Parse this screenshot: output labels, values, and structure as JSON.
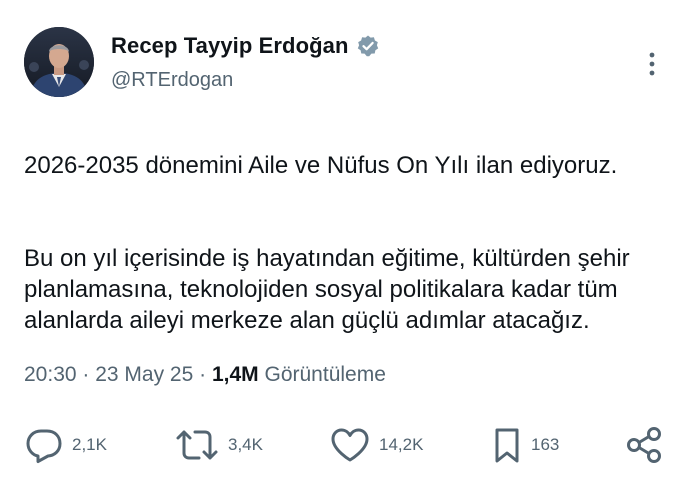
{
  "author": {
    "display_name": "Recep Tayyip Erdoğan",
    "handle": "@RTErdogan",
    "verified": true,
    "avatar": "profile-photo"
  },
  "tweet": {
    "paragraph_1": "2026-2035 dönemini Aile ve Nüfus On Yılı ilan ediyoruz.",
    "paragraph_2": "Bu on yıl içerisinde iş hayatından eğitime, kültürden şehir planlamasına, teknolojiden sosyal politikalara kadar tüm alanlarda aileyi merkeze alan güçlü adımlar atacağız."
  },
  "meta": {
    "time": "20:30",
    "separator_1": " · ",
    "date": "23 May 25",
    "separator_2": " · ",
    "views_count": "1,4M",
    "views_label": " Görüntüleme"
  },
  "actions": {
    "replies": "2,1K",
    "retweets": "3,4K",
    "likes": "14,2K",
    "bookmarks": "163"
  },
  "icons": {
    "reply": "reply-icon",
    "retweet": "retweet-icon",
    "like": "heart-icon",
    "bookmark": "bookmark-icon",
    "share": "share-icon",
    "more": "more-vertical-icon",
    "verified": "verified-badge-icon"
  },
  "colors": {
    "text": "#0f1419",
    "secondary": "#536471",
    "icon": "#536471",
    "verified_badge": "#829aab"
  }
}
